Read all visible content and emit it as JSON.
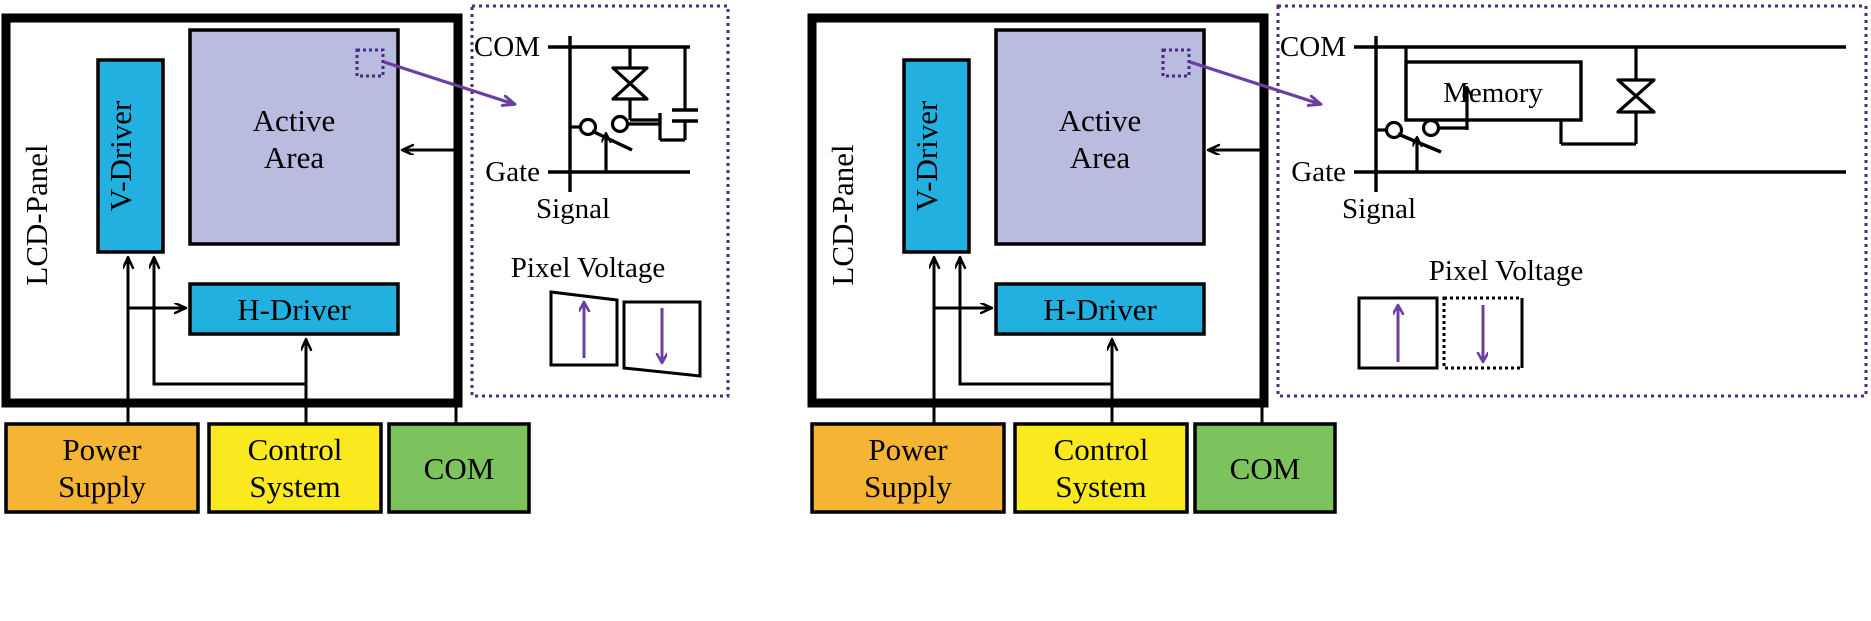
{
  "figure": {
    "type": "schematic-diagram",
    "description": "Two LCD panel system block diagrams with pixel circuit insets",
    "colors": {
      "driver_blue": "#22b0e0",
      "active_area_lavender": "#b9bbdf",
      "power_orange": "#f5b433",
      "control_yellow": "#fbe91f",
      "com_green": "#7cc35e",
      "arrow_purple": "#6b3fa0",
      "inset_border_purple": "#4b2a86",
      "outline_black": "#000000",
      "background_white": "#ffffff"
    }
  },
  "panels": [
    {
      "id": "panel-left",
      "lcd_panel_label": "LCD-Panel",
      "blocks": {
        "v_driver": "V-Driver",
        "active_area_line1": "Active",
        "active_area_line2": "Area",
        "h_driver": "H-Driver"
      },
      "bottom_blocks": [
        {
          "id": "power-supply",
          "line1": "Power",
          "line2": "Supply",
          "color": "#f5b433"
        },
        {
          "id": "control-system",
          "line1": "Control",
          "line2": "System",
          "color": "#fbe91f"
        },
        {
          "id": "com",
          "line1": "COM",
          "line2": "",
          "color": "#7cc35e"
        }
      ],
      "inset": {
        "circuit_labels": {
          "com": "COM",
          "gate": "Gate",
          "signal": "Signal"
        },
        "has_memory_block": false,
        "memory_label": "",
        "pixel_voltage_title": "Pixel Voltage",
        "waveform_style": "trapezoid-decaying"
      }
    },
    {
      "id": "panel-right",
      "lcd_panel_label": "LCD-Panel",
      "blocks": {
        "v_driver": "V-Driver",
        "active_area_line1": "Active",
        "active_area_line2": "Area",
        "h_driver": "H-Driver"
      },
      "bottom_blocks": [
        {
          "id": "power-supply",
          "line1": "Power",
          "line2": "Supply",
          "color": "#f5b433"
        },
        {
          "id": "control-system",
          "line1": "Control",
          "line2": "System",
          "color": "#fbe91f"
        },
        {
          "id": "com",
          "line1": "COM",
          "line2": "",
          "color": "#7cc35e"
        }
      ],
      "inset": {
        "circuit_labels": {
          "com": "COM",
          "gate": "Gate",
          "signal": "Signal"
        },
        "has_memory_block": true,
        "memory_label": "Memory",
        "pixel_voltage_title": "Pixel Voltage",
        "waveform_style": "rectangular-flat"
      }
    }
  ]
}
